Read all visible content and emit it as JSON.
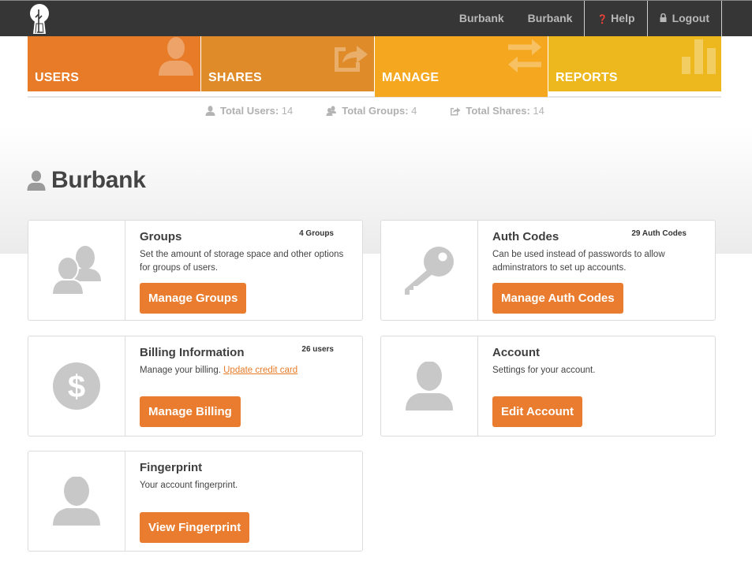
{
  "topbar": {
    "logo_icon": "tree-keyhole-logo-icon",
    "links": [
      {
        "label": "Burbank"
      },
      {
        "label": "Burbank"
      },
      {
        "label": "Help",
        "icon": "question-circle-icon"
      },
      {
        "label": "Logout",
        "icon": "lock-icon"
      }
    ]
  },
  "tabs": [
    {
      "label": "USERS",
      "icon": "user-icon",
      "color": "#e77b28",
      "active": false
    },
    {
      "label": "SHARES",
      "icon": "share-icon",
      "color": "#e08b29",
      "active": false
    },
    {
      "label": "MANAGE",
      "icon": "exchange-arrows-icon",
      "color": "#f4a71f",
      "active": true
    },
    {
      "label": "REPORTS",
      "icon": "bar-chart-icon",
      "color": "#ecb81e",
      "active": false
    }
  ],
  "stats": [
    {
      "label": "Total Users:",
      "value": "14",
      "icon": "user-icon"
    },
    {
      "label": "Total Groups:",
      "value": "4",
      "icon": "group-icon"
    },
    {
      "label": "Total Shares:",
      "value": "14",
      "icon": "share-icon"
    }
  ],
  "page": {
    "title": "Burbank",
    "title_icon": "user-icon"
  },
  "cards": [
    {
      "title": "Groups",
      "badge": "4 Groups",
      "description": "Set the amount of storage space and other options for groups of users.",
      "button": "Manage Groups",
      "icon": "group-icon"
    },
    {
      "title": "Auth Codes",
      "badge": "29 Auth Codes",
      "description": "Can be used instead of passwords to allow adminstrators to set up accounts.",
      "button": "Manage Auth Codes",
      "icon": "key-icon"
    },
    {
      "title": "Billing Information",
      "badge": "26 users",
      "description": "Manage your billing.",
      "link": "Update credit card",
      "button": "Manage Billing",
      "icon": "dollar-circle-icon"
    },
    {
      "title": "Account",
      "badge": "",
      "description": "Settings for your account.",
      "button": "Edit Account",
      "icon": "user-icon"
    },
    {
      "title": "Fingerprint",
      "badge": "",
      "description": "Your account fingerprint.",
      "button": "View Fingerprint",
      "icon": "user-icon"
    }
  ],
  "colors": {
    "accent": "#e97c2e",
    "topbar": "#363636"
  }
}
